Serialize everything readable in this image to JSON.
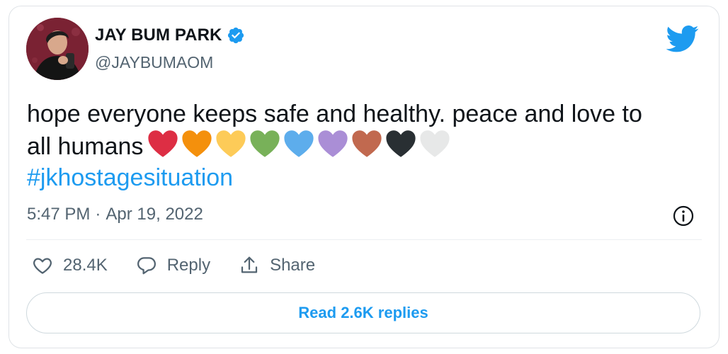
{
  "author": {
    "display_name": "JAY BUM PARK",
    "handle": "@JAYBUMAOM",
    "verified": true
  },
  "tweet": {
    "text_line1": "hope everyone keeps safe and healthy. peace and love to",
    "text_line2": "all humans",
    "hearts": [
      {
        "name": "red-heart-icon",
        "color": "#dd2e44"
      },
      {
        "name": "orange-heart-icon",
        "color": "#f4900c"
      },
      {
        "name": "yellow-heart-icon",
        "color": "#fdcb58"
      },
      {
        "name": "green-heart-icon",
        "color": "#78b159"
      },
      {
        "name": "blue-heart-icon",
        "color": "#5dadec"
      },
      {
        "name": "purple-heart-icon",
        "color": "#aa8ed6"
      },
      {
        "name": "brown-heart-icon",
        "color": "#c1694f"
      },
      {
        "name": "black-heart-icon",
        "color": "#292f33"
      },
      {
        "name": "white-heart-icon",
        "color": "#e7e8e8"
      }
    ],
    "hashtag": "#jkhostagesituation"
  },
  "meta": {
    "time": "5:47 PM",
    "separator": "·",
    "date": "Apr 19, 2022"
  },
  "actions": {
    "like_count": "28.4K",
    "reply_label": "Reply",
    "share_label": "Share"
  },
  "replies_button_label": "Read 2.6K replies",
  "colors": {
    "accent": "#1d9bf0",
    "text": "#0f1419",
    "secondary": "#536471",
    "border": "#cfd9de"
  }
}
